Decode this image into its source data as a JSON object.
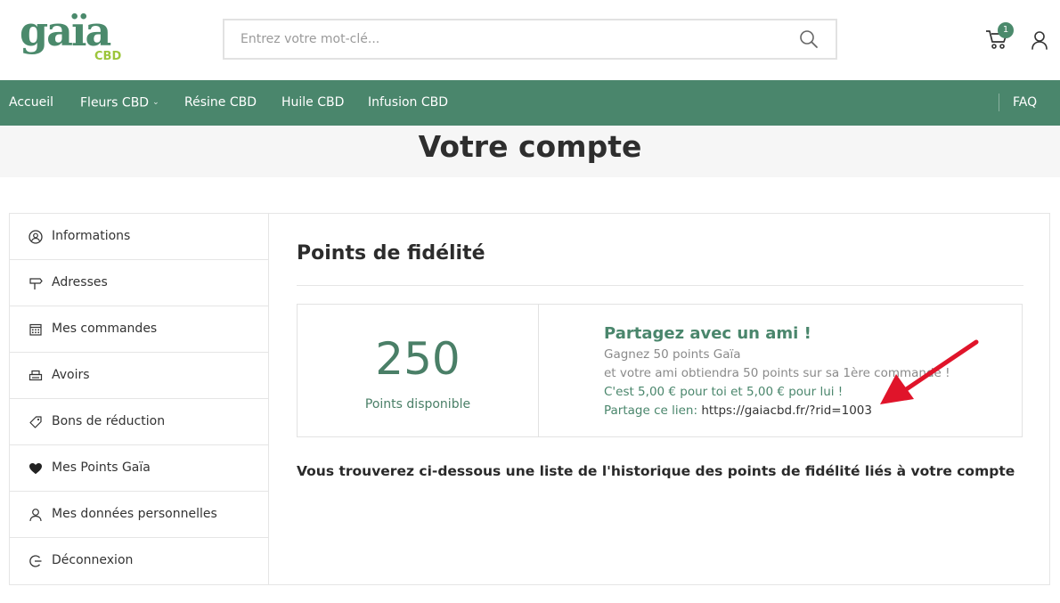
{
  "brand": {
    "logo_main": "gaïa",
    "logo_sub": "CBD",
    "color": "#4a866c",
    "accent": "#9cc53b"
  },
  "search": {
    "placeholder": "Entrez votre mot-clé...",
    "icon": "search-icon"
  },
  "header": {
    "cart_count": "1",
    "cart_icon": "cart-icon",
    "user_icon": "user-icon"
  },
  "nav": {
    "items": [
      {
        "label": "Accueil"
      },
      {
        "label": "Fleurs CBD",
        "has_dropdown": true
      },
      {
        "label": "Résine CBD"
      },
      {
        "label": "Huile CBD"
      },
      {
        "label": "Infusion CBD"
      }
    ],
    "faq": "FAQ"
  },
  "page_title": "Votre compte",
  "sidebar": {
    "items": [
      {
        "label": "Informations",
        "icon": "user-circle-icon"
      },
      {
        "label": "Adresses",
        "icon": "signpost-icon"
      },
      {
        "label": "Mes commandes",
        "icon": "calendar-icon"
      },
      {
        "label": "Avoirs",
        "icon": "printer-icon"
      },
      {
        "label": "Bons de réduction",
        "icon": "tag-icon"
      },
      {
        "label": "Mes Points Gaïa",
        "icon": "heart-icon"
      },
      {
        "label": "Mes données personnelles",
        "icon": "user-icon"
      },
      {
        "label": "Déconnexion",
        "icon": "logout-icon"
      }
    ]
  },
  "main": {
    "section_title": "Points de fidélité",
    "points": {
      "value": "250",
      "label": "Points disponible"
    },
    "share": {
      "title": "Partagez avec un ami !",
      "line1": "Gagnez 50 points Gaïa",
      "line2": "et votre ami obtiendra 50 points sur sa 1ère commande !",
      "line3": "C'est 5,00 € pour toi et 5,00 € pour lui !",
      "link_label": "Partage ce lien: ",
      "link": "https://gaiacbd.fr/?rid=1003"
    },
    "history_text": "Vous trouverez ci-dessous une liste de l'historique des points de fidélité liés à votre compte"
  },
  "annotation": {
    "arrow_color": "#e0142a"
  }
}
